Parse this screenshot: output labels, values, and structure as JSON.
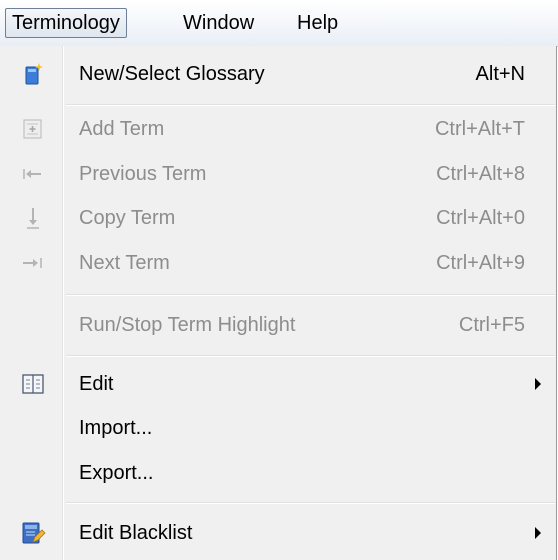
{
  "menubar": {
    "items": [
      {
        "label": "Terminology"
      },
      {
        "label": "Window"
      },
      {
        "label": "Help"
      }
    ]
  },
  "menu": {
    "items": [
      {
        "label": "New/Select Glossary",
        "shortcut": "Alt+N",
        "icon": "new-glossary-icon",
        "enabled": true
      },
      {
        "label": "Add Term",
        "shortcut": "Ctrl+Alt+T",
        "icon": "add-term-icon",
        "enabled": false
      },
      {
        "label": "Previous Term",
        "shortcut": "Ctrl+Alt+8",
        "icon": "previous-term-icon",
        "enabled": false
      },
      {
        "label": "Copy Term",
        "shortcut": "Ctrl+Alt+0",
        "icon": "copy-term-icon",
        "enabled": false
      },
      {
        "label": "Next Term",
        "shortcut": "Ctrl+Alt+9",
        "icon": "next-term-icon",
        "enabled": false
      },
      {
        "label": "Run/Stop Term Highlight",
        "shortcut": "Ctrl+F5",
        "enabled": false
      },
      {
        "label": "Edit",
        "icon": "edit-glossary-icon",
        "enabled": true,
        "submenu": true
      },
      {
        "label": "Import...",
        "enabled": true
      },
      {
        "label": "Export...",
        "enabled": true
      },
      {
        "label": "Edit Blacklist",
        "icon": "edit-blacklist-icon",
        "enabled": true,
        "submenu": true
      }
    ]
  }
}
